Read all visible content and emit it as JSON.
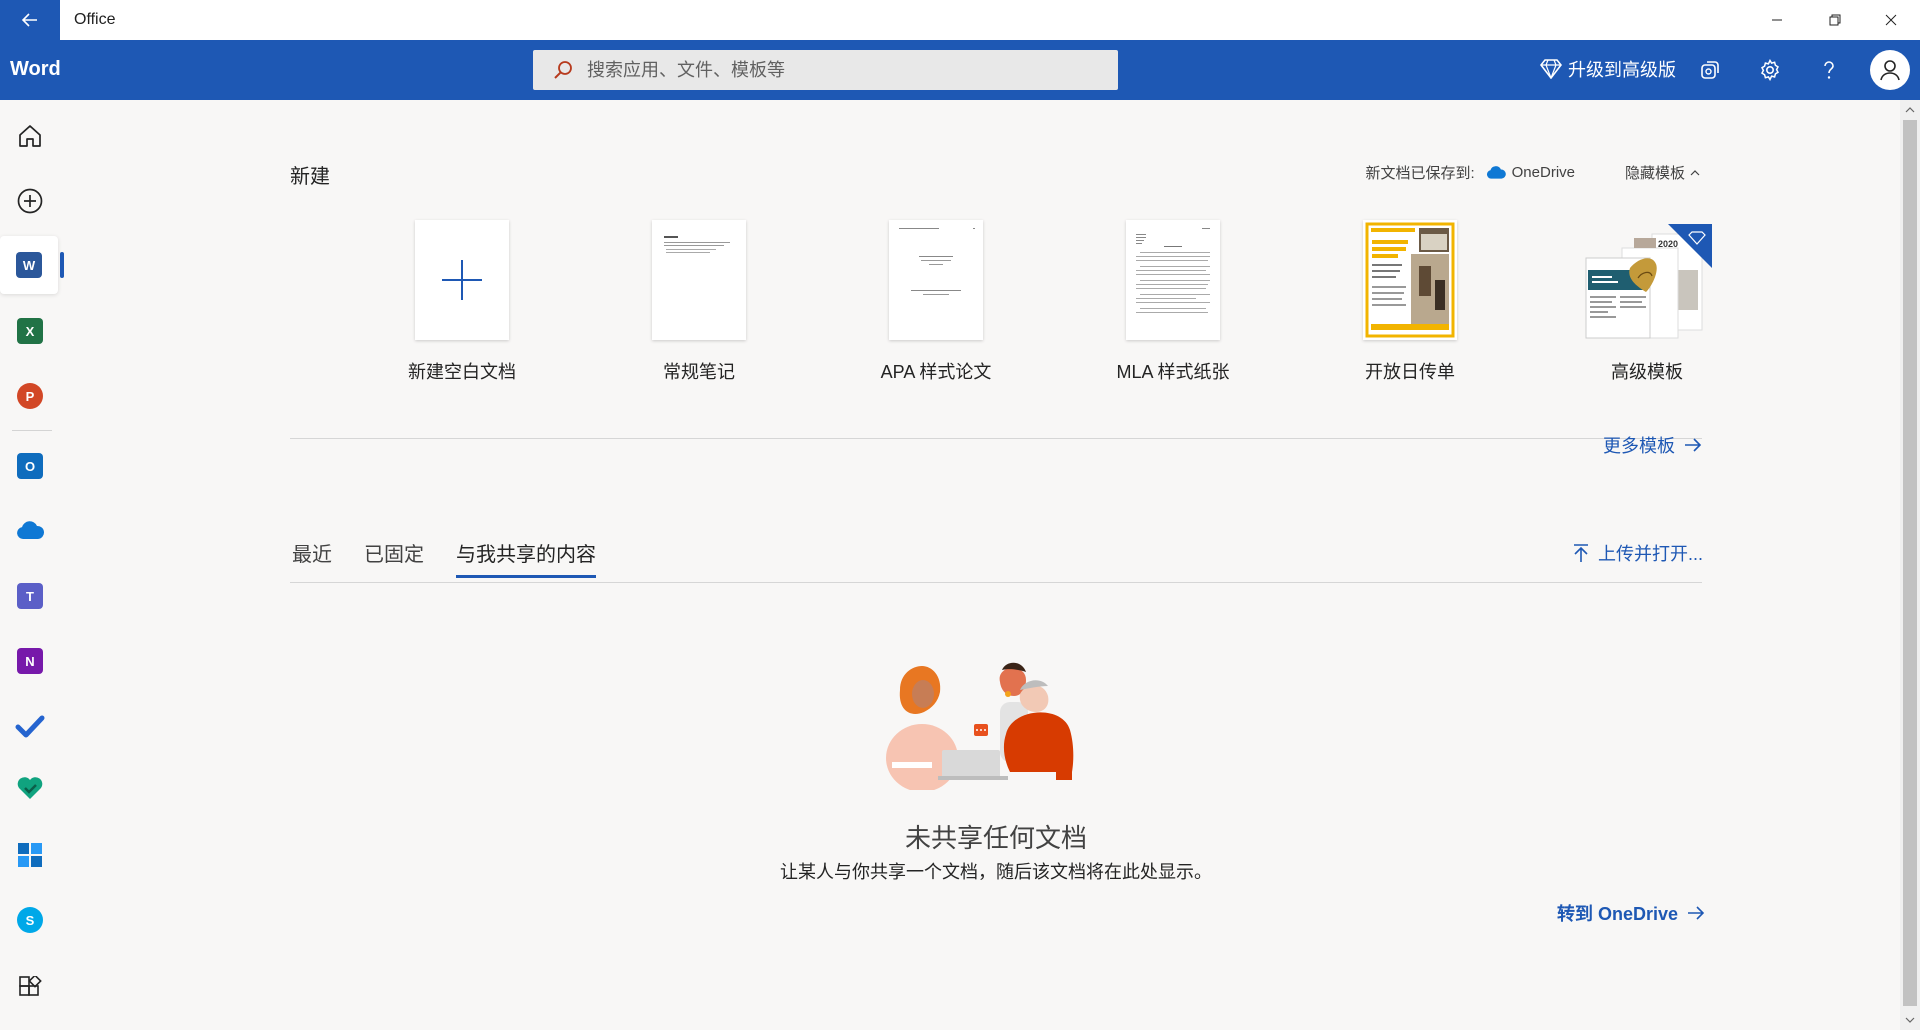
{
  "window": {
    "title": "Office",
    "controls": [
      "minimize",
      "restore",
      "close"
    ]
  },
  "header": {
    "app_name": "Word",
    "search_placeholder": "搜索应用、文件、模板等",
    "upgrade_label": "升级到高级版",
    "icons": [
      "premium-diamond-icon",
      "feedback-icon",
      "settings-gear-icon",
      "help-icon",
      "account-icon"
    ],
    "brand_color": "#1e58b4"
  },
  "sidebar": {
    "items": [
      {
        "name": "home",
        "icon": "home-icon"
      },
      {
        "name": "create",
        "icon": "plus-circle-icon"
      },
      {
        "name": "word",
        "icon": "word-icon",
        "active": true
      },
      {
        "name": "excel",
        "icon": "excel-icon"
      },
      {
        "name": "powerpoint",
        "icon": "powerpoint-icon"
      },
      {
        "name": "outlook",
        "icon": "outlook-icon"
      },
      {
        "name": "onedrive",
        "icon": "onedrive-icon"
      },
      {
        "name": "teams",
        "icon": "teams-icon"
      },
      {
        "name": "onenote",
        "icon": "onenote-icon"
      },
      {
        "name": "todo",
        "icon": "todo-check-icon"
      },
      {
        "name": "family-safety",
        "icon": "family-safety-icon"
      },
      {
        "name": "calendar",
        "icon": "calendar-tile-icon"
      },
      {
        "name": "skype",
        "icon": "skype-icon"
      },
      {
        "name": "all-apps",
        "icon": "all-apps-icon"
      }
    ],
    "tile_letters": {
      "word": "W",
      "excel": "X",
      "powerpoint": "P",
      "outlook": "O",
      "teams": "T",
      "onenote": "N",
      "skype": "S"
    }
  },
  "new_section": {
    "title": "新建",
    "save_prefix": "新文档已保存到:",
    "save_location": "OneDrive",
    "hide_templates": "隐藏模板",
    "templates": [
      {
        "label": "新建空白文档",
        "kind": "blank"
      },
      {
        "label": "常规笔记",
        "kind": "notes"
      },
      {
        "label": "APA 样式论文",
        "kind": "apa"
      },
      {
        "label": "MLA 样式纸张",
        "kind": "mla"
      },
      {
        "label": "开放日传单",
        "kind": "flyer"
      },
      {
        "label": "高级模板",
        "kind": "premium",
        "badge_year": "2020"
      }
    ],
    "more_templates": "更多模板"
  },
  "files_section": {
    "tabs": [
      {
        "label": "最近",
        "active": false
      },
      {
        "label": "已固定",
        "active": false
      },
      {
        "label": "与我共享的内容",
        "active": true
      }
    ],
    "upload_label": "上传并打开...",
    "empty_title": "未共享任何文档",
    "empty_subtitle": "让某人与你共享一个文档，随后该文档将在此处显示。",
    "goto_label": "转到 OneDrive"
  }
}
